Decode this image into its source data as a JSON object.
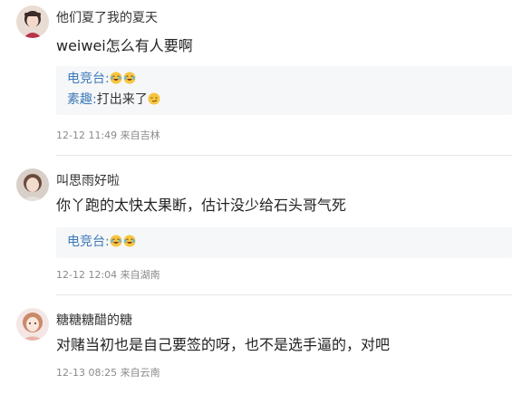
{
  "comments": [
    {
      "username": "他们夏了我的夏天",
      "content": "weiwei怎么有人要啊",
      "replies": [
        {
          "name": "电竞台:",
          "text": "",
          "emojis": [
            "laugh-cry-emoji",
            "laugh-cry-emoji"
          ]
        },
        {
          "name": "素趣:",
          "text": "打出来了",
          "emojis": [
            "smirk-emoji"
          ]
        }
      ],
      "meta": "12-12 11:49 来自吉林"
    },
    {
      "username": "叫思雨好啦",
      "content": "你丫跑的太快太果断，估计没少给石头哥气死",
      "replies": [
        {
          "name": "电竞台:",
          "text": "",
          "emojis": [
            "laugh-cry-emoji",
            "laugh-cry-emoji"
          ]
        }
      ],
      "meta": "12-12 12:04 来自湖南"
    },
    {
      "username": "糖糖糖醋的糖",
      "content": "对赌当初也是自己要签的呀，也不是选手逼的，对吧",
      "replies": [],
      "meta": "12-13 08:25 来自云南"
    }
  ],
  "colors": {
    "reply_name": "#3d7ab8",
    "meta": "#8a8a8a",
    "reply_bg": "#f6f7f9",
    "divider": "#e8e8e8"
  }
}
